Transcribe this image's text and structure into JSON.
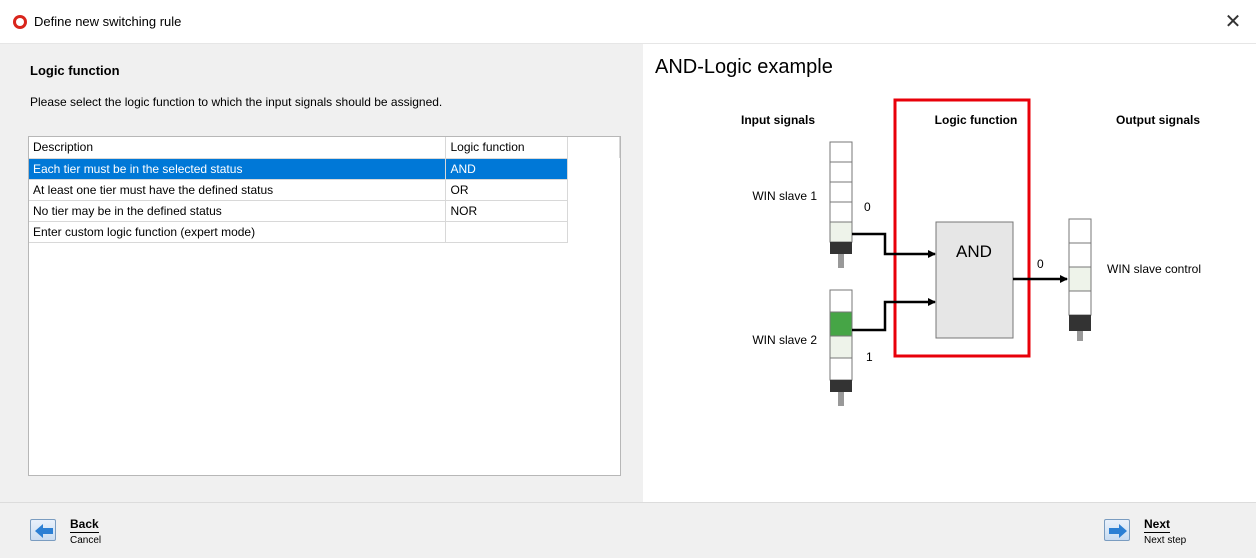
{
  "window": {
    "title": "Define new switching rule",
    "close_icon": "close-icon"
  },
  "left": {
    "section_title": "Logic function",
    "description": "Please select the logic function to which the input signals should be assigned.",
    "table": {
      "headers": [
        "Description",
        "Logic function",
        ""
      ],
      "rows": [
        {
          "description": "Each tier must be in the selected status",
          "logic": "AND",
          "selected": true
        },
        {
          "description": "At least one tier must have the defined status",
          "logic": "OR",
          "selected": false
        },
        {
          "description": "No tier may be in the defined status",
          "logic": "NOR",
          "selected": false
        },
        {
          "description": "Enter custom logic function (expert mode)",
          "logic": "",
          "selected": false
        }
      ]
    }
  },
  "example": {
    "title": "AND-Logic example",
    "col_input": "Input signals",
    "col_logic": "Logic function",
    "col_output": "Output signals",
    "slave1_label": "WIN slave 1",
    "slave1_value": "0",
    "slave2_label": "WIN slave 2",
    "slave2_value": "1",
    "gate_label": "AND",
    "output_value": "0",
    "output_label": "WIN slave control",
    "highlight_color": "#e8000a",
    "lit_color": "#46a546"
  },
  "footer": {
    "back_label": "Back",
    "back_sub": "Cancel",
    "next_label": "Next",
    "next_sub": "Next step"
  }
}
